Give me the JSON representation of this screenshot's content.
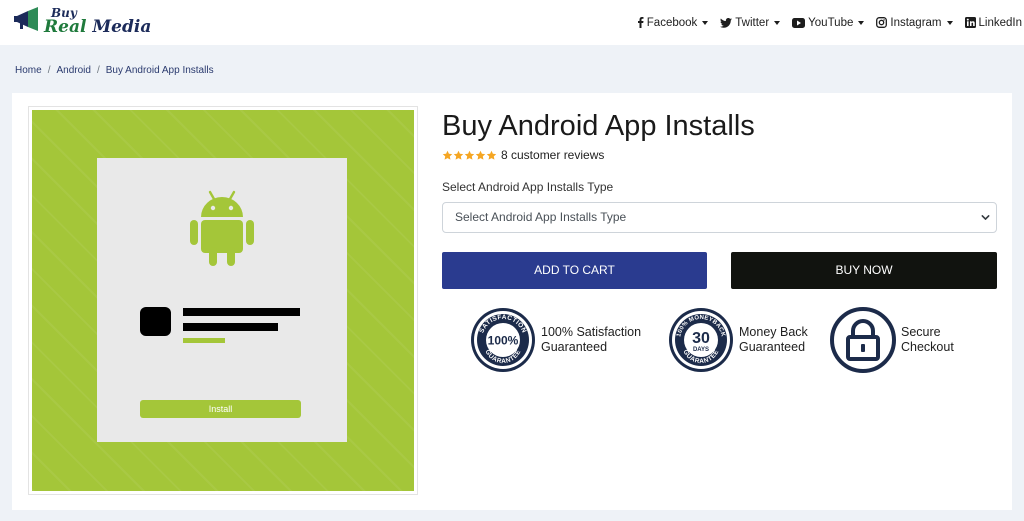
{
  "logo": {
    "line1": "Buy",
    "line2a": "Real",
    "line2b": " Media"
  },
  "nav": {
    "items": [
      {
        "label": "Facebook",
        "icon": "facebook-icon",
        "has_caret": true
      },
      {
        "label": "Twitter",
        "icon": "twitter-icon",
        "has_caret": true
      },
      {
        "label": "YouTube",
        "icon": "youtube-icon",
        "has_caret": true
      },
      {
        "label": "Instagram",
        "icon": "instagram-icon",
        "has_caret": true
      },
      {
        "label": "LinkedIn",
        "icon": "linkedin-icon",
        "has_caret": false
      }
    ]
  },
  "breadcrumb": {
    "home": "Home",
    "category": "Android",
    "current": "Buy Android App Installs",
    "separator": "/"
  },
  "product": {
    "title": "Buy Android App Installs",
    "rating_stars": 5,
    "reviews_text": "8 customer reviews",
    "select_label": "Select Android App Installs Type",
    "select_value": "Select Android App Installs Type",
    "add_to_cart": "ADD TO CART",
    "buy_now": "BUY NOW",
    "image_button": "Install"
  },
  "badges": [
    {
      "line1": "100% Satisfaction",
      "line2": "Guaranteed",
      "seal": "100%",
      "seal_top": "SATISFACTION",
      "seal_bottom": "GUARANTEE"
    },
    {
      "line1": "Money Back",
      "line2": "Guaranteed",
      "seal": "30",
      "seal_sub": "DAYS",
      "seal_top": "100% MONEYBACK",
      "seal_bottom": "GUARANTEE"
    },
    {
      "line1": "Secure",
      "line2": "Checkout",
      "seal_icon": "lock-icon"
    }
  ],
  "colors": {
    "brand_navy": "#2a3b8f",
    "buy_black": "#11130f",
    "android_green": "#a4c639",
    "star": "#f5a623",
    "seal_navy": "#1c2b4a"
  }
}
